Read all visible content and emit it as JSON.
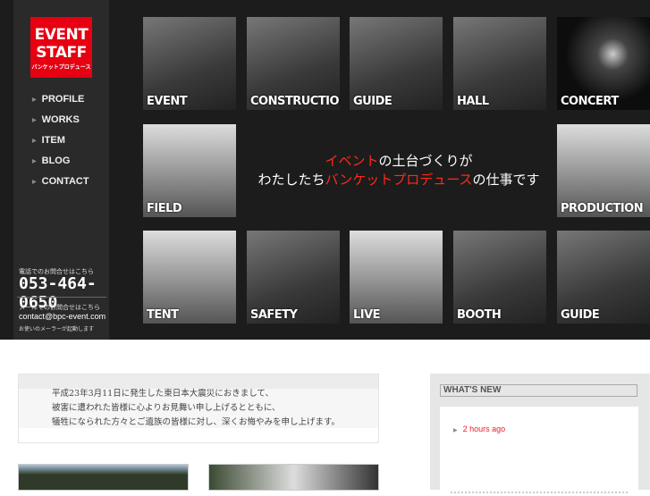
{
  "logo": {
    "line1": "EVENT",
    "line2": "STAFF",
    "sub": "バンケットプロデュース"
  },
  "nav": [
    "PROFILE",
    "WORKS",
    "ITEM",
    "BLOG",
    "CONTACT"
  ],
  "contact": {
    "phone_caption": "電話でのお問合せはこちら",
    "phone": "053-464-0650",
    "mail_caption": "メールでのお問合せはこちら",
    "email": "contact@bpc-event.com",
    "mail_note": "お使いのメーラーが起動します"
  },
  "tiles": [
    "EVENT",
    "CONSTRUCTION",
    "GUIDE",
    "HALL",
    "CONCERT",
    "FIELD",
    "PRODUCTION",
    "TENT",
    "SAFETY",
    "LIVE",
    "BOOTH",
    "GUIDE"
  ],
  "slogan": {
    "a": "イベント",
    "b": "の土台づくりが",
    "c": "わたしたち",
    "d": "バンケットプロデュース",
    "e": "の仕事です"
  },
  "notice": [
    "平成23年3月11日に発生した東日本大震災におきまして、",
    "被害に遭われた皆様に心よりお見舞い申し上げるとともに、",
    "犠牲になられた方々とご遺族の皆様に対し、深くお悔やみを申し上げます。"
  ],
  "news": {
    "title": "WHAT'S NEW",
    "item": "2 hours ago"
  }
}
